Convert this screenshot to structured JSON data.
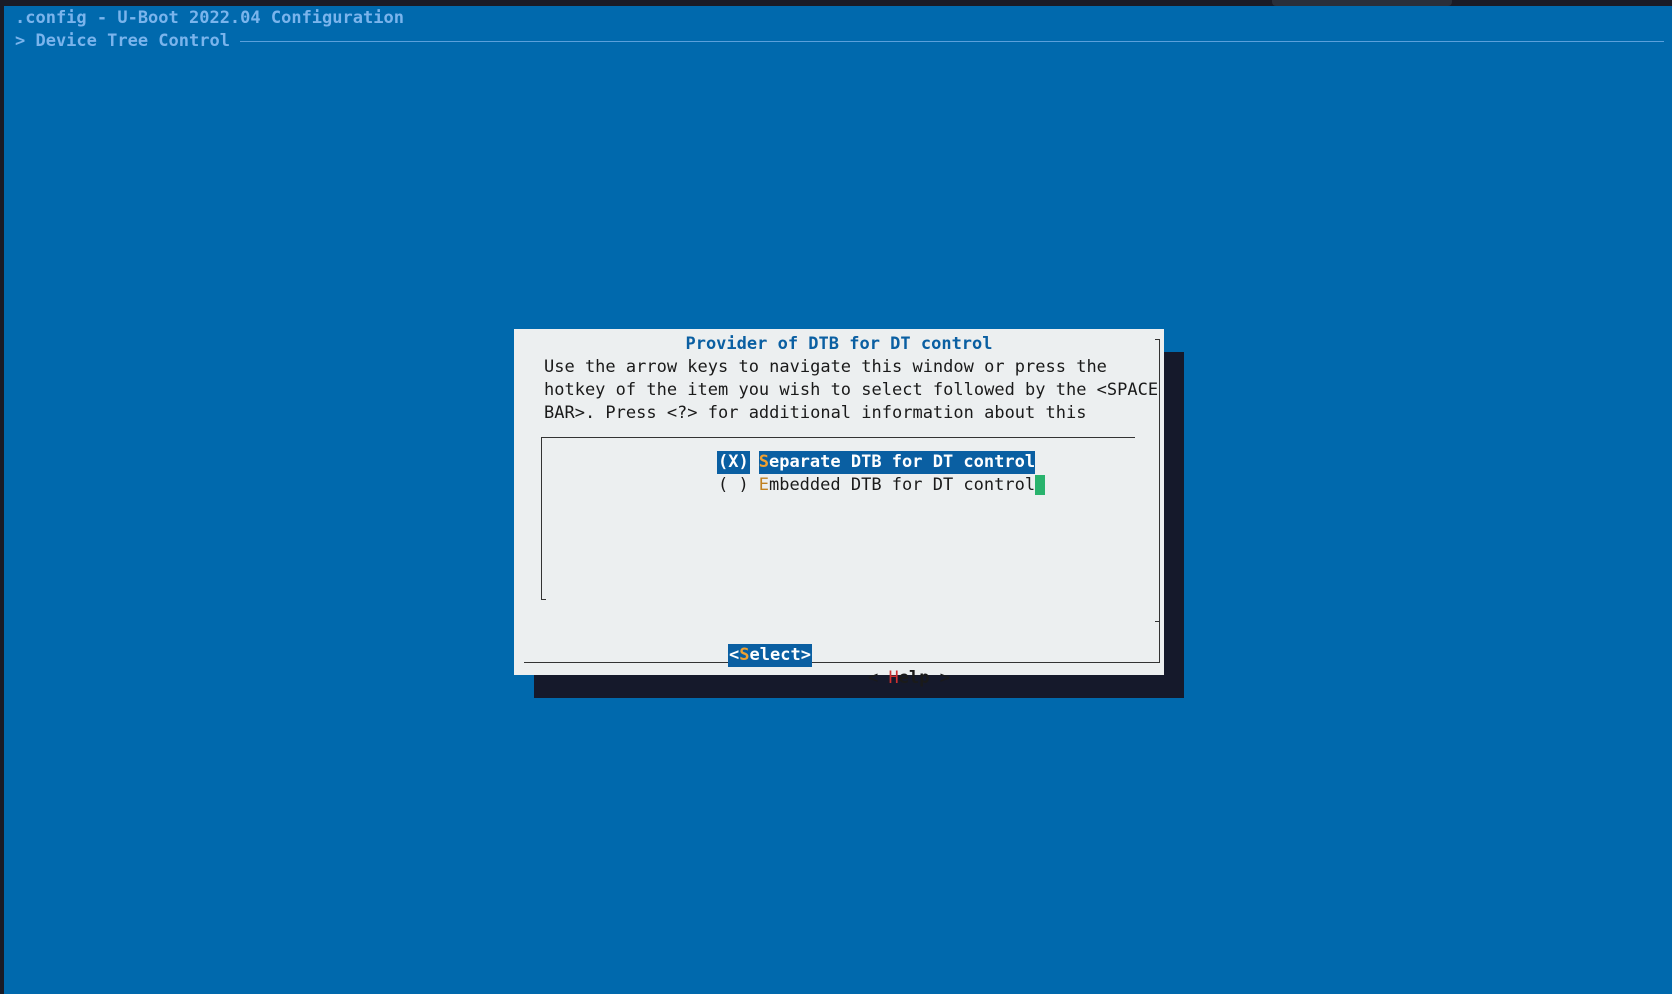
{
  "app": {
    "title": ".config - U-Boot 2022.04 Configuration",
    "breadcrumb": "> Device Tree Control"
  },
  "dialog": {
    "title": "Provider of DTB for DT control",
    "help_lines": [
      "Use the arrow keys to navigate this window or press the",
      "hotkey of the item you wish to select followed by the <SPACE",
      "BAR>. Press <?> for additional information about this"
    ],
    "options": [
      {
        "radio": "(X)",
        "hotkey": "S",
        "rest": "eparate DTB for DT control",
        "selected": true
      },
      {
        "radio": "( )",
        "hotkey": "E",
        "rest": "mbedded DTB for DT control",
        "selected": false
      }
    ],
    "buttons": {
      "select": {
        "open": "<",
        "hotkey": "S",
        "rest": "elect",
        "close": ">"
      },
      "help": {
        "open": "< ",
        "hotkey": "H",
        "rest": "elp",
        "close": " >"
      }
    }
  },
  "colors": {
    "background": "#0069ad",
    "dialog_bg": "#eceff0",
    "highlight": "#0a5fa2",
    "hotkey": "#f0a030",
    "cursor": "#29b36d"
  }
}
